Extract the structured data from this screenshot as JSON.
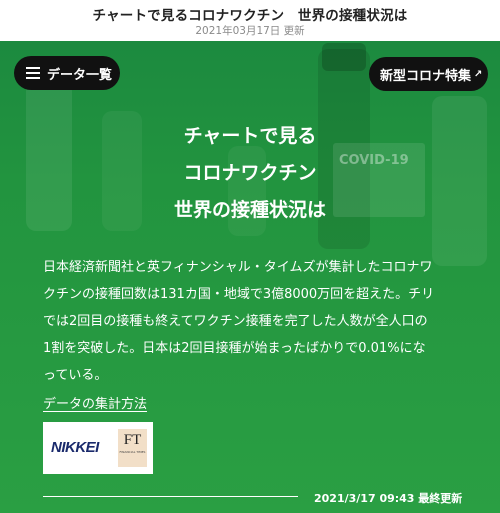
{
  "header": {
    "title": "チャートで見るコロナワクチン　世界の接種状況は",
    "updated": "2021年03月17日 更新"
  },
  "hero": {
    "data_list_label": "データ一覧",
    "corona_feature_label": "新型コロナ特集",
    "vial_text": "COVID-19",
    "headline": [
      "チャートで見る",
      "コロナワクチン",
      "世界の接種状況は"
    ],
    "paragraph_lines": [
      "日本経済新聞社と英フィナンシャル・タイムズが集計したコロナワ",
      "クチンの接種回数は131カ国・地域で3億8000万回を超えた。チリ",
      "では2回目の接種も終えてワクチン接種を完了した人数が全人口の",
      "1割を突破した。日本は2回目接種が始まったばかりで0.01%にな",
      "っている。"
    ],
    "method_link": "データの集計方法",
    "logos": {
      "nikkei": "NIKKEI",
      "ft": "FT",
      "ft_sub": "FINANCIAL TIMES"
    },
    "last_update": "2021/3/17 09:43 最終更新"
  },
  "colors": {
    "hero_green": "#22943f",
    "pill_black": "#111111",
    "nikkei_navy": "#1a2a6c",
    "ft_salmon": "#f2dfc8"
  }
}
